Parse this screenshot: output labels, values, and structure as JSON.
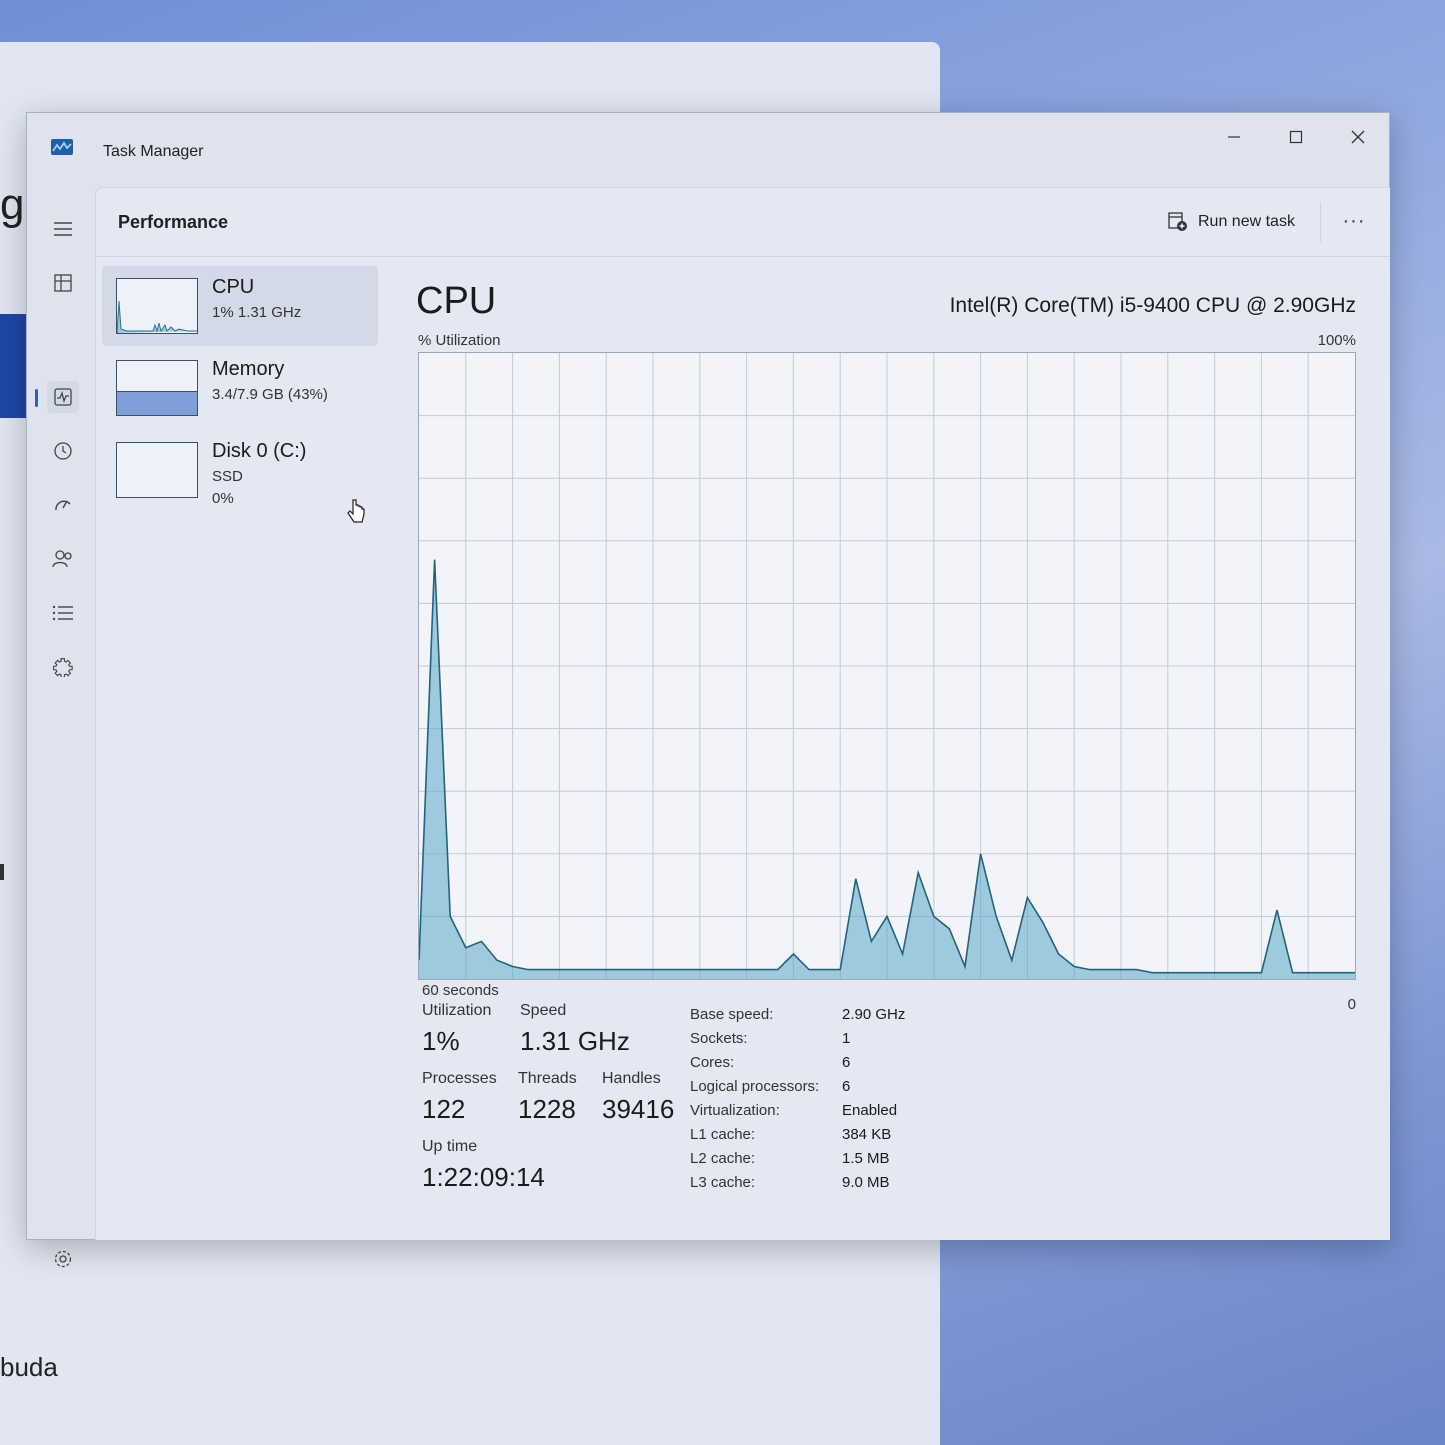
{
  "background": {
    "partial_text_top": "gh",
    "partial_text_bottom": "buda"
  },
  "window": {
    "title": "Task Manager",
    "controls": {
      "minimize": "—",
      "maximize": "☐",
      "close": "✕"
    }
  },
  "nav": {
    "items": [
      "hamburger-icon",
      "processes-icon",
      "performance-icon",
      "app-history-icon",
      "startup-apps-icon",
      "users-icon",
      "details-icon",
      "services-icon"
    ],
    "selected": "performance-icon",
    "settings": "gear-icon"
  },
  "header": {
    "title": "Performance",
    "run_new_task": "Run new task",
    "more": "···"
  },
  "devices": [
    {
      "name": "CPU",
      "sub1": "1%  1.31 GHz",
      "sub2": "",
      "selected": true
    },
    {
      "name": "Memory",
      "sub1": "3.4/7.9 GB (43%)",
      "sub2": "",
      "fill_fraction": 0.43
    },
    {
      "name": "Disk 0 (C:)",
      "sub1": "SSD",
      "sub2": "0%"
    }
  ],
  "detail": {
    "title": "CPU",
    "model": "Intel(R) Core(TM) i5-9400 CPU @ 2.90GHz",
    "y_label": "% Utilization",
    "y_max_label": "100%",
    "x_left_label": "60 seconds",
    "x_right_label": "0"
  },
  "chart_data": {
    "type": "area",
    "x": [
      60,
      59,
      58,
      57,
      56,
      55,
      54,
      53,
      52,
      51,
      50,
      49,
      48,
      47,
      46,
      45,
      44,
      43,
      42,
      41,
      40,
      39,
      38,
      37,
      36,
      35,
      34,
      33,
      32,
      31,
      30,
      29,
      28,
      27,
      26,
      25,
      24,
      23,
      22,
      21,
      20,
      19,
      18,
      17,
      16,
      15,
      14,
      13,
      12,
      11,
      10,
      9,
      8,
      7,
      6,
      5,
      4,
      3,
      2,
      1,
      0
    ],
    "y": [
      3,
      67,
      10,
      5,
      6,
      3,
      2,
      1.5,
      1.5,
      1.5,
      1.5,
      1.5,
      1.5,
      1.5,
      1.5,
      1.5,
      1.5,
      1.5,
      1.5,
      1.5,
      1.5,
      1.5,
      1.5,
      1.5,
      4,
      1.5,
      1.5,
      1.5,
      16,
      6,
      10,
      4,
      17,
      10,
      8,
      2,
      20,
      10,
      3,
      13,
      9,
      4,
      2,
      1.5,
      1.5,
      1.5,
      1.5,
      1,
      1,
      1,
      1,
      1,
      1,
      1,
      1,
      11,
      1,
      1,
      1,
      1,
      1
    ],
    "ylim": [
      0,
      100
    ],
    "xlabel": "60 seconds",
    "ylabel": "% Utilization",
    "grid": true,
    "color": "#5aa7c8"
  },
  "stats": {
    "utilization_label": "Utilization",
    "utilization_value": "1%",
    "speed_label": "Speed",
    "speed_value": "1.31 GHz",
    "processes_label": "Processes",
    "processes_value": "122",
    "threads_label": "Threads",
    "threads_value": "1228",
    "handles_label": "Handles",
    "handles_value": "39416",
    "uptime_label": "Up time",
    "uptime_value": "1:22:09:14"
  },
  "specs": [
    {
      "key": "Base speed:",
      "value": "2.90 GHz"
    },
    {
      "key": "Sockets:",
      "value": "1"
    },
    {
      "key": "Cores:",
      "value": "6"
    },
    {
      "key": "Logical processors:",
      "value": "6"
    },
    {
      "key": "Virtualization:",
      "value": "Enabled"
    },
    {
      "key": "L1 cache:",
      "value": "384 KB"
    },
    {
      "key": "L2 cache:",
      "value": "1.5 MB"
    },
    {
      "key": "L3 cache:",
      "value": "9.0 MB"
    }
  ]
}
